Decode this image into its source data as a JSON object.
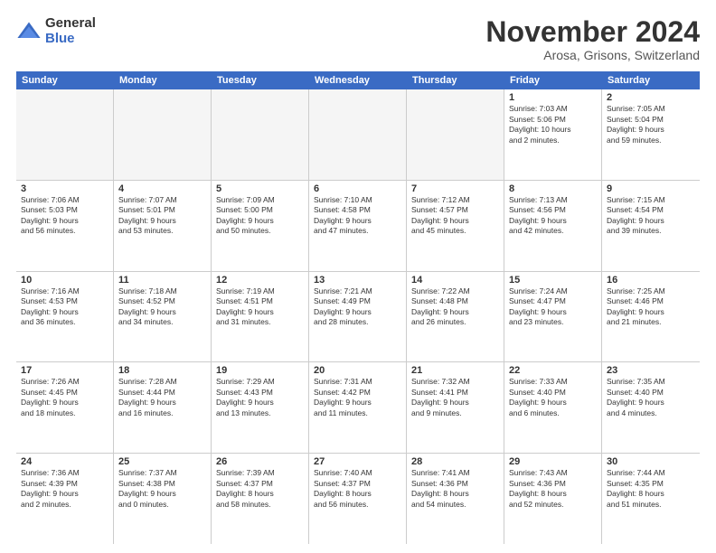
{
  "logo": {
    "general": "General",
    "blue": "Blue"
  },
  "title": "November 2024",
  "location": "Arosa, Grisons, Switzerland",
  "header_days": [
    "Sunday",
    "Monday",
    "Tuesday",
    "Wednesday",
    "Thursday",
    "Friday",
    "Saturday"
  ],
  "rows": [
    [
      {
        "day": "",
        "info": "",
        "empty": true
      },
      {
        "day": "",
        "info": "",
        "empty": true
      },
      {
        "day": "",
        "info": "",
        "empty": true
      },
      {
        "day": "",
        "info": "",
        "empty": true
      },
      {
        "day": "",
        "info": "",
        "empty": true
      },
      {
        "day": "1",
        "info": "Sunrise: 7:03 AM\nSunset: 5:06 PM\nDaylight: 10 hours\nand 2 minutes.",
        "empty": false
      },
      {
        "day": "2",
        "info": "Sunrise: 7:05 AM\nSunset: 5:04 PM\nDaylight: 9 hours\nand 59 minutes.",
        "empty": false
      }
    ],
    [
      {
        "day": "3",
        "info": "Sunrise: 7:06 AM\nSunset: 5:03 PM\nDaylight: 9 hours\nand 56 minutes.",
        "empty": false
      },
      {
        "day": "4",
        "info": "Sunrise: 7:07 AM\nSunset: 5:01 PM\nDaylight: 9 hours\nand 53 minutes.",
        "empty": false
      },
      {
        "day": "5",
        "info": "Sunrise: 7:09 AM\nSunset: 5:00 PM\nDaylight: 9 hours\nand 50 minutes.",
        "empty": false
      },
      {
        "day": "6",
        "info": "Sunrise: 7:10 AM\nSunset: 4:58 PM\nDaylight: 9 hours\nand 47 minutes.",
        "empty": false
      },
      {
        "day": "7",
        "info": "Sunrise: 7:12 AM\nSunset: 4:57 PM\nDaylight: 9 hours\nand 45 minutes.",
        "empty": false
      },
      {
        "day": "8",
        "info": "Sunrise: 7:13 AM\nSunset: 4:56 PM\nDaylight: 9 hours\nand 42 minutes.",
        "empty": false
      },
      {
        "day": "9",
        "info": "Sunrise: 7:15 AM\nSunset: 4:54 PM\nDaylight: 9 hours\nand 39 minutes.",
        "empty": false
      }
    ],
    [
      {
        "day": "10",
        "info": "Sunrise: 7:16 AM\nSunset: 4:53 PM\nDaylight: 9 hours\nand 36 minutes.",
        "empty": false
      },
      {
        "day": "11",
        "info": "Sunrise: 7:18 AM\nSunset: 4:52 PM\nDaylight: 9 hours\nand 34 minutes.",
        "empty": false
      },
      {
        "day": "12",
        "info": "Sunrise: 7:19 AM\nSunset: 4:51 PM\nDaylight: 9 hours\nand 31 minutes.",
        "empty": false
      },
      {
        "day": "13",
        "info": "Sunrise: 7:21 AM\nSunset: 4:49 PM\nDaylight: 9 hours\nand 28 minutes.",
        "empty": false
      },
      {
        "day": "14",
        "info": "Sunrise: 7:22 AM\nSunset: 4:48 PM\nDaylight: 9 hours\nand 26 minutes.",
        "empty": false
      },
      {
        "day": "15",
        "info": "Sunrise: 7:24 AM\nSunset: 4:47 PM\nDaylight: 9 hours\nand 23 minutes.",
        "empty": false
      },
      {
        "day": "16",
        "info": "Sunrise: 7:25 AM\nSunset: 4:46 PM\nDaylight: 9 hours\nand 21 minutes.",
        "empty": false
      }
    ],
    [
      {
        "day": "17",
        "info": "Sunrise: 7:26 AM\nSunset: 4:45 PM\nDaylight: 9 hours\nand 18 minutes.",
        "empty": false
      },
      {
        "day": "18",
        "info": "Sunrise: 7:28 AM\nSunset: 4:44 PM\nDaylight: 9 hours\nand 16 minutes.",
        "empty": false
      },
      {
        "day": "19",
        "info": "Sunrise: 7:29 AM\nSunset: 4:43 PM\nDaylight: 9 hours\nand 13 minutes.",
        "empty": false
      },
      {
        "day": "20",
        "info": "Sunrise: 7:31 AM\nSunset: 4:42 PM\nDaylight: 9 hours\nand 11 minutes.",
        "empty": false
      },
      {
        "day": "21",
        "info": "Sunrise: 7:32 AM\nSunset: 4:41 PM\nDaylight: 9 hours\nand 9 minutes.",
        "empty": false
      },
      {
        "day": "22",
        "info": "Sunrise: 7:33 AM\nSunset: 4:40 PM\nDaylight: 9 hours\nand 6 minutes.",
        "empty": false
      },
      {
        "day": "23",
        "info": "Sunrise: 7:35 AM\nSunset: 4:40 PM\nDaylight: 9 hours\nand 4 minutes.",
        "empty": false
      }
    ],
    [
      {
        "day": "24",
        "info": "Sunrise: 7:36 AM\nSunset: 4:39 PM\nDaylight: 9 hours\nand 2 minutes.",
        "empty": false
      },
      {
        "day": "25",
        "info": "Sunrise: 7:37 AM\nSunset: 4:38 PM\nDaylight: 9 hours\nand 0 minutes.",
        "empty": false
      },
      {
        "day": "26",
        "info": "Sunrise: 7:39 AM\nSunset: 4:37 PM\nDaylight: 8 hours\nand 58 minutes.",
        "empty": false
      },
      {
        "day": "27",
        "info": "Sunrise: 7:40 AM\nSunset: 4:37 PM\nDaylight: 8 hours\nand 56 minutes.",
        "empty": false
      },
      {
        "day": "28",
        "info": "Sunrise: 7:41 AM\nSunset: 4:36 PM\nDaylight: 8 hours\nand 54 minutes.",
        "empty": false
      },
      {
        "day": "29",
        "info": "Sunrise: 7:43 AM\nSunset: 4:36 PM\nDaylight: 8 hours\nand 52 minutes.",
        "empty": false
      },
      {
        "day": "30",
        "info": "Sunrise: 7:44 AM\nSunset: 4:35 PM\nDaylight: 8 hours\nand 51 minutes.",
        "empty": false
      }
    ]
  ]
}
